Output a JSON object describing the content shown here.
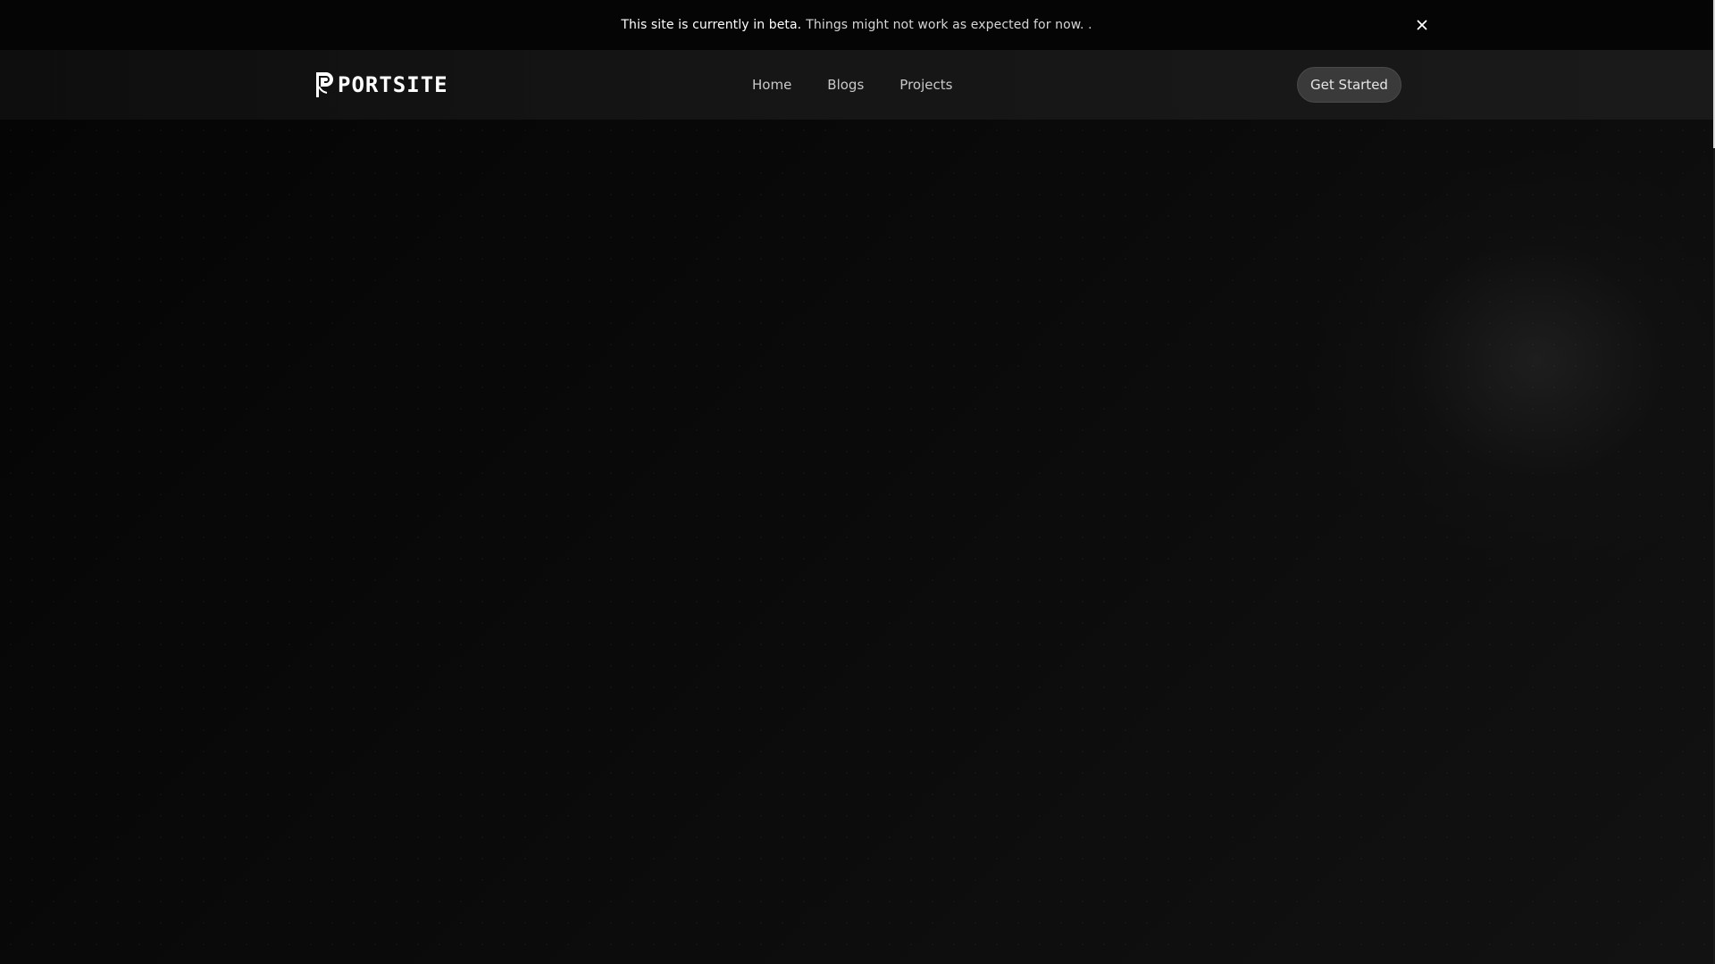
{
  "banner": {
    "strong_text": "This site is currently in beta.",
    "text": "Things might not work as expected for now. .",
    "close_icon": "close-icon"
  },
  "navbar": {
    "logo_text": "PORTSITE",
    "logo_icon": "portsite-logo-icon",
    "links": [
      {
        "label": "Home"
      },
      {
        "label": "Blogs"
      },
      {
        "label": "Projects"
      }
    ],
    "cta_label": "Get Started"
  },
  "colors": {
    "background": "#0b0b0b",
    "banner_background": "#050505",
    "cta_background": "#3a3a3a",
    "text_primary": "#ffffff",
    "text_secondary": "#c9c9c9"
  }
}
